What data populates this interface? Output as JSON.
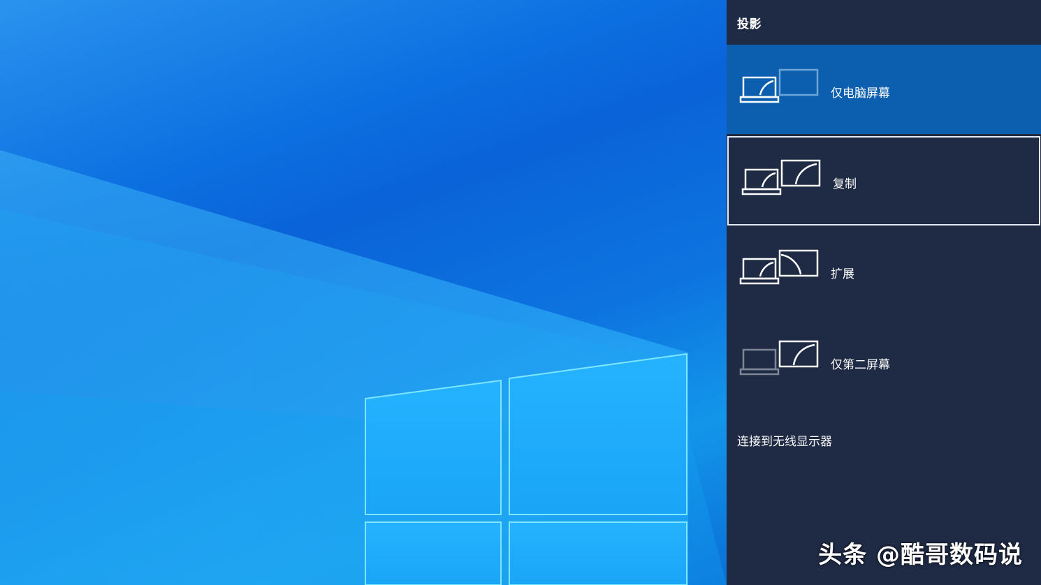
{
  "panel": {
    "title": "投影",
    "options": [
      {
        "label": "仅电脑屏幕",
        "laptop_icon": "laptop-icon",
        "monitor_icon": "monitor-blank-icon",
        "state": "selected"
      },
      {
        "label": "复制",
        "laptop_icon": "laptop-icon",
        "monitor_icon": "monitor-icon",
        "state": "focused"
      },
      {
        "label": "扩展",
        "laptop_icon": "laptop-icon",
        "monitor_icon": "monitor-icon",
        "state": "normal"
      },
      {
        "label": "仅第二屏幕",
        "laptop_icon": "laptop-dimmed-icon",
        "monitor_icon": "monitor-icon",
        "state": "normal"
      }
    ],
    "wireless_link": "连接到无线显示器"
  },
  "watermark": "头条 @酷哥数码说",
  "colors": {
    "panel_bg": "#1f2a44",
    "selected_bg": "#0b5fae",
    "focus_border": "#e6e9f0",
    "desktop_blue": "#0a63d8"
  }
}
